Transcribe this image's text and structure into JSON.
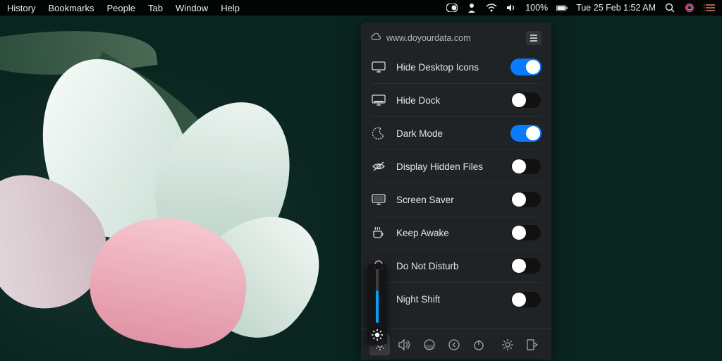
{
  "menubar": {
    "items": [
      "History",
      "Bookmarks",
      "People",
      "Tab",
      "Window",
      "Help"
    ],
    "battery": "100%",
    "datetime": "Tue 25 Feb  1:52 AM"
  },
  "panel": {
    "title": "www.doyourdata.com",
    "rows": [
      {
        "label": "Hide Desktop Icons",
        "on": true
      },
      {
        "label": "Hide Dock",
        "on": false
      },
      {
        "label": "Dark Mode",
        "on": true
      },
      {
        "label": "Display Hidden Files",
        "on": false
      },
      {
        "label": "Screen Saver",
        "on": false
      },
      {
        "label": "Keep Awake",
        "on": false
      },
      {
        "label": "Do Not Disturb",
        "on": false
      },
      {
        "label": "Night Shift",
        "on": false
      }
    ],
    "footer_icons": [
      "brightness",
      "volume",
      "disk",
      "back",
      "power",
      "settings",
      "exit"
    ]
  },
  "brightness": {
    "value_pct": 60
  },
  "colors": {
    "accent_on": "#0a7aff",
    "panel_bg": "#202326"
  }
}
